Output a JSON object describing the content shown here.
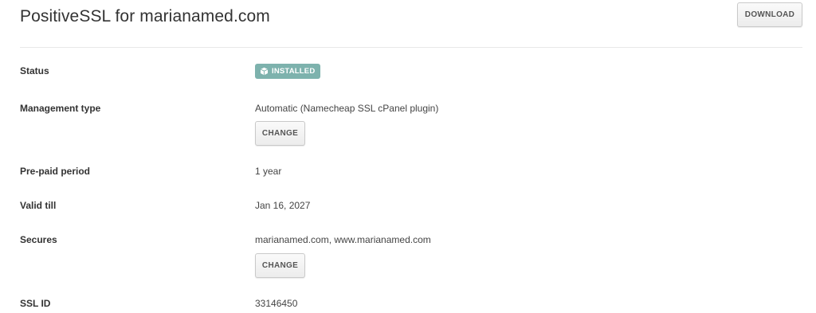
{
  "header": {
    "title": "PositiveSSL for marianamed.com",
    "download_label": "DOWNLOAD"
  },
  "details": {
    "status": {
      "label": "Status",
      "badge_text": "INSTALLED",
      "badge_icon": "box-icon",
      "badge_color": "#7db2ad"
    },
    "management_type": {
      "label": "Management type",
      "value": "Automatic (Namecheap SSL cPanel plugin)",
      "change_label": "CHANGE"
    },
    "prepaid_period": {
      "label": "Pre-paid period",
      "value": "1 year"
    },
    "valid_till": {
      "label": "Valid till",
      "value": "Jan 16, 2027"
    },
    "secures": {
      "label": "Secures",
      "value": "marianamed.com, www.marianamed.com",
      "change_label": "CHANGE"
    },
    "ssl_id": {
      "label": "SSL ID",
      "value": "33146450"
    }
  }
}
